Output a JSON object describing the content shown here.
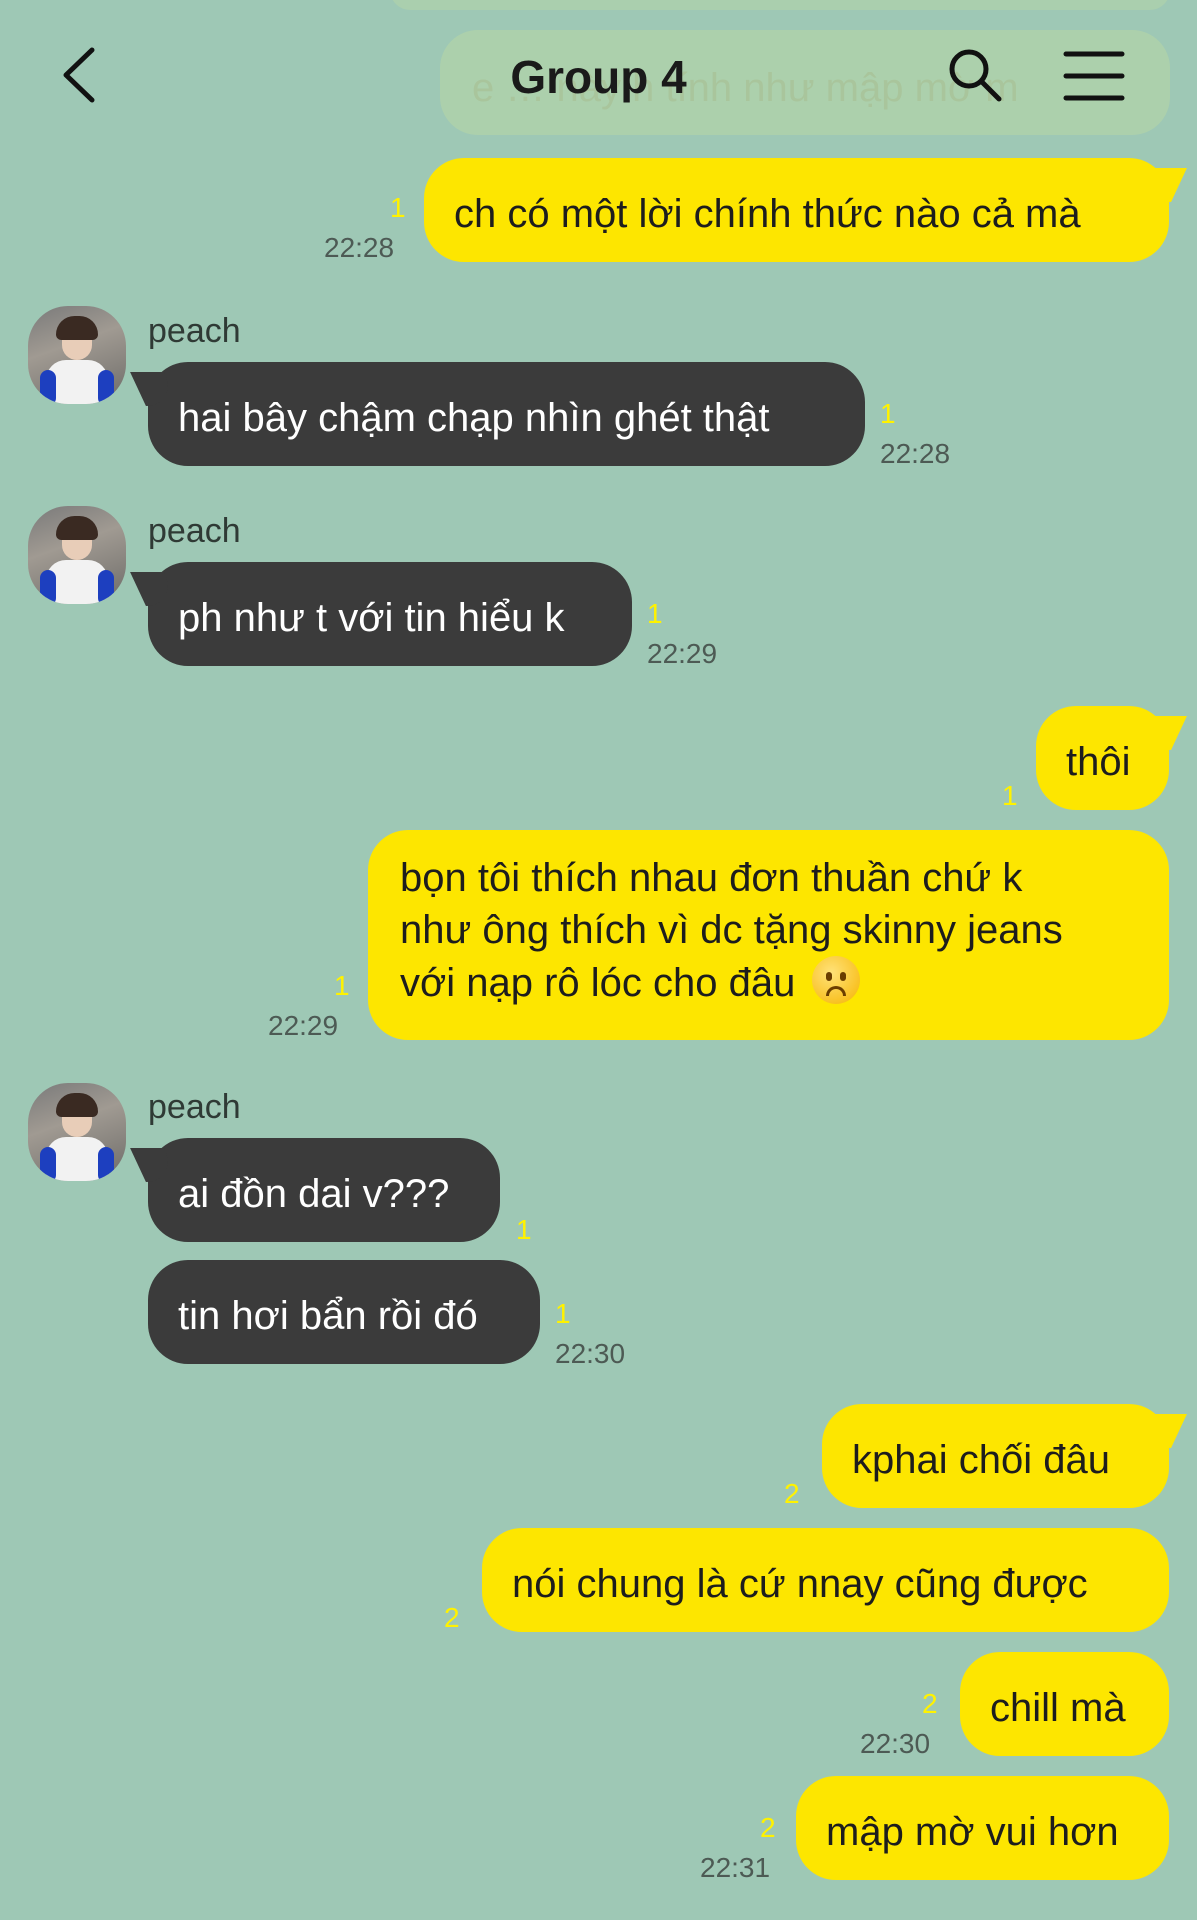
{
  "header": {
    "title": "Group 4",
    "ghost_text": "e … này h tính như mập mờ m"
  },
  "messages": [
    {
      "text": "ch có một lời chính thức nào cả mà",
      "unread": "1",
      "time": "22:28"
    },
    {
      "sender": "peach",
      "text": "hai bây chậm chạp nhìn ghét thật",
      "unread": "1",
      "time": "22:28"
    },
    {
      "sender": "peach",
      "text": "ph như t với tin hiểu k",
      "unread": "1",
      "time": "22:29"
    },
    {
      "text": "thôi",
      "unread": "1"
    },
    {
      "lines": [
        "bọn tôi thích nhau đơn thuần chứ k",
        "như ông thích vì dc tặng skinny jeans",
        "với nạp rô lóc cho đâu"
      ],
      "emoji": "frowning-face",
      "unread": "1",
      "time": "22:29"
    },
    {
      "sender": "peach",
      "text": "ai đồn dai v???",
      "unread": "1"
    },
    {
      "text": "tin hơi bẩn rồi đó",
      "unread": "1",
      "time": "22:30"
    },
    {
      "text": "kphai chối đâu",
      "unread": "2"
    },
    {
      "text": "nói chung là cứ nnay cũng được",
      "unread": "2"
    },
    {
      "text": "chill mà",
      "unread": "2",
      "time": "22:30"
    },
    {
      "text": "mập mờ vui hơn",
      "unread": "2",
      "time": "22:31"
    }
  ],
  "colors": {
    "background": "#9ec8b5",
    "my_bubble": "#fde600",
    "their_bubble": "#3b3b3b",
    "unread": "#fff200"
  }
}
